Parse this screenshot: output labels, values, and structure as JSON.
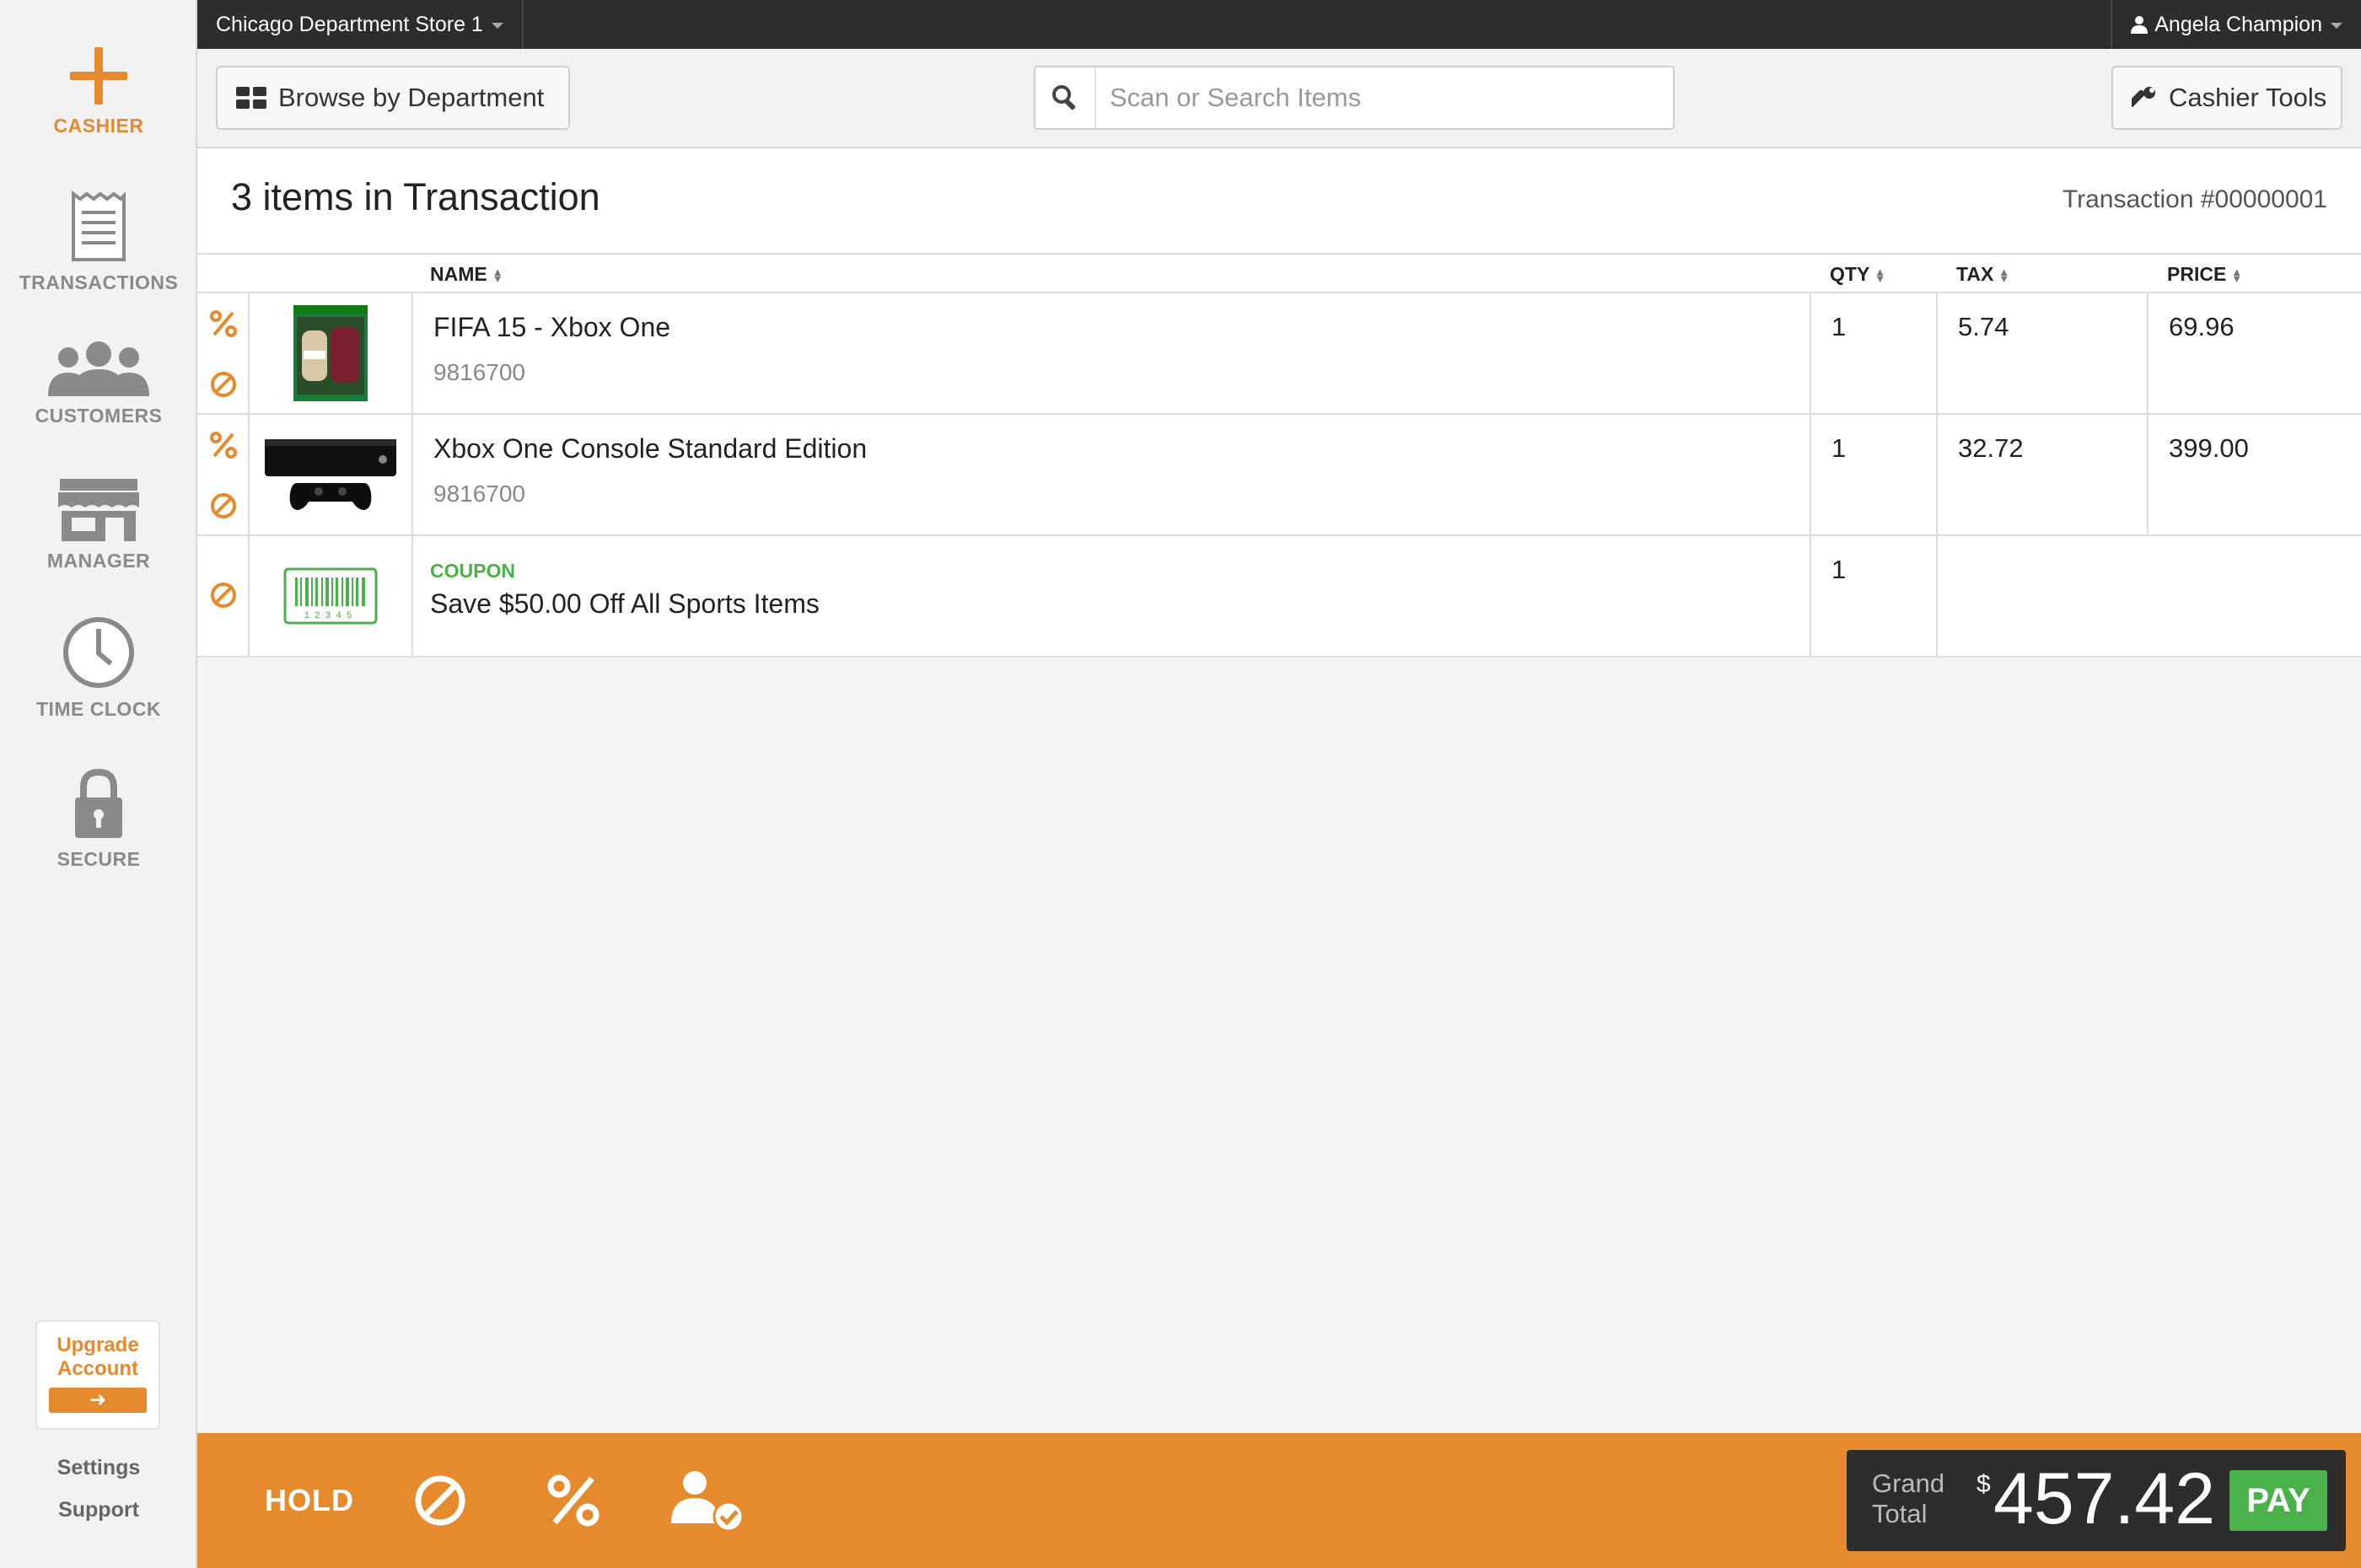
{
  "sidebar": {
    "items": [
      {
        "label": "CASHIER",
        "icon": "plus-icon"
      },
      {
        "label": "TRANSACTIONS",
        "icon": "receipt-icon"
      },
      {
        "label": "CUSTOMERS",
        "icon": "users-icon"
      },
      {
        "label": "MANAGER",
        "icon": "store-icon"
      },
      {
        "label": "TIME CLOCK",
        "icon": "clock-icon"
      },
      {
        "label": "SECURE",
        "icon": "lock-icon"
      }
    ],
    "upgrade_line1": "Upgrade",
    "upgrade_line2": "Account",
    "upgrade_arrow": "➜",
    "settings": "Settings",
    "support": "Support"
  },
  "topbar": {
    "store": "Chicago Department Store 1",
    "user": "Angela Champion"
  },
  "toolbar": {
    "browse_label": "Browse by Department",
    "search_placeholder": "Scan or Search Items",
    "tools_label": "Cashier Tools"
  },
  "transaction": {
    "title": "3 items in Transaction",
    "number": "Transaction #00000001"
  },
  "table": {
    "headers": {
      "name": "NAME",
      "qty": "QTY",
      "tax": "TAX",
      "price": "PRICE"
    },
    "rows": [
      {
        "name": "FIFA 15 - Xbox One",
        "sku": "9816700",
        "qty": "1",
        "tax": "5.74",
        "price": "69.96"
      },
      {
        "name": "Xbox One Console Standard Edition",
        "sku": "9816700",
        "qty": "1",
        "tax": "32.72",
        "price": "399.00"
      },
      {
        "type_label": "COUPON",
        "name": "Save $50.00 Off All Sports Items",
        "qty": "1",
        "barcode_digits": "12345"
      }
    ]
  },
  "footer": {
    "hold": "HOLD",
    "grand": "Grand",
    "total": "Total",
    "currency": "$",
    "amount": "457.42",
    "pay": "PAY"
  },
  "colors": {
    "accent": "#e68a2e",
    "dark": "#2d2d2d",
    "pay_green": "#4bb14b",
    "coupon_green": "#4bb14b"
  }
}
